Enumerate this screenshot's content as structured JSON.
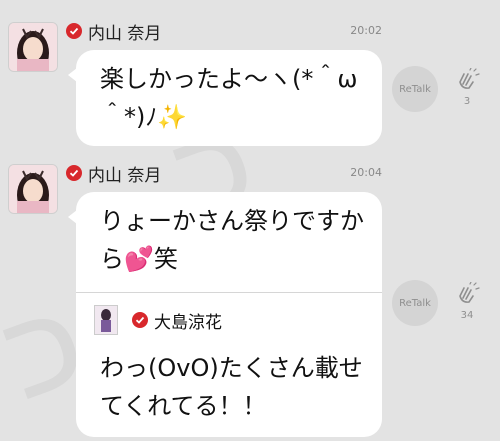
{
  "messages": [
    {
      "author": "内山 奈月",
      "time": "20:02",
      "text": "楽しかったよ〜ヽ(*＾ω＾*)ﾉ✨",
      "retalk_label": "ReTalk",
      "clap_count": "3"
    },
    {
      "author": "内山 奈月",
      "time": "20:04",
      "text": "りょーかさん祭りですから💕笑",
      "retalk_label": "ReTalk",
      "clap_count": "34",
      "quote": {
        "author": "大島涼花",
        "text": "わっ(OvO)たくさん載せてくれてる！！"
      }
    }
  ],
  "icons": {
    "verified": "verified-check-icon",
    "clap": "clap-icon"
  },
  "colors": {
    "verified_badge": "#d8282c",
    "background": "#e3e3e3",
    "bubble": "#ffffff"
  }
}
